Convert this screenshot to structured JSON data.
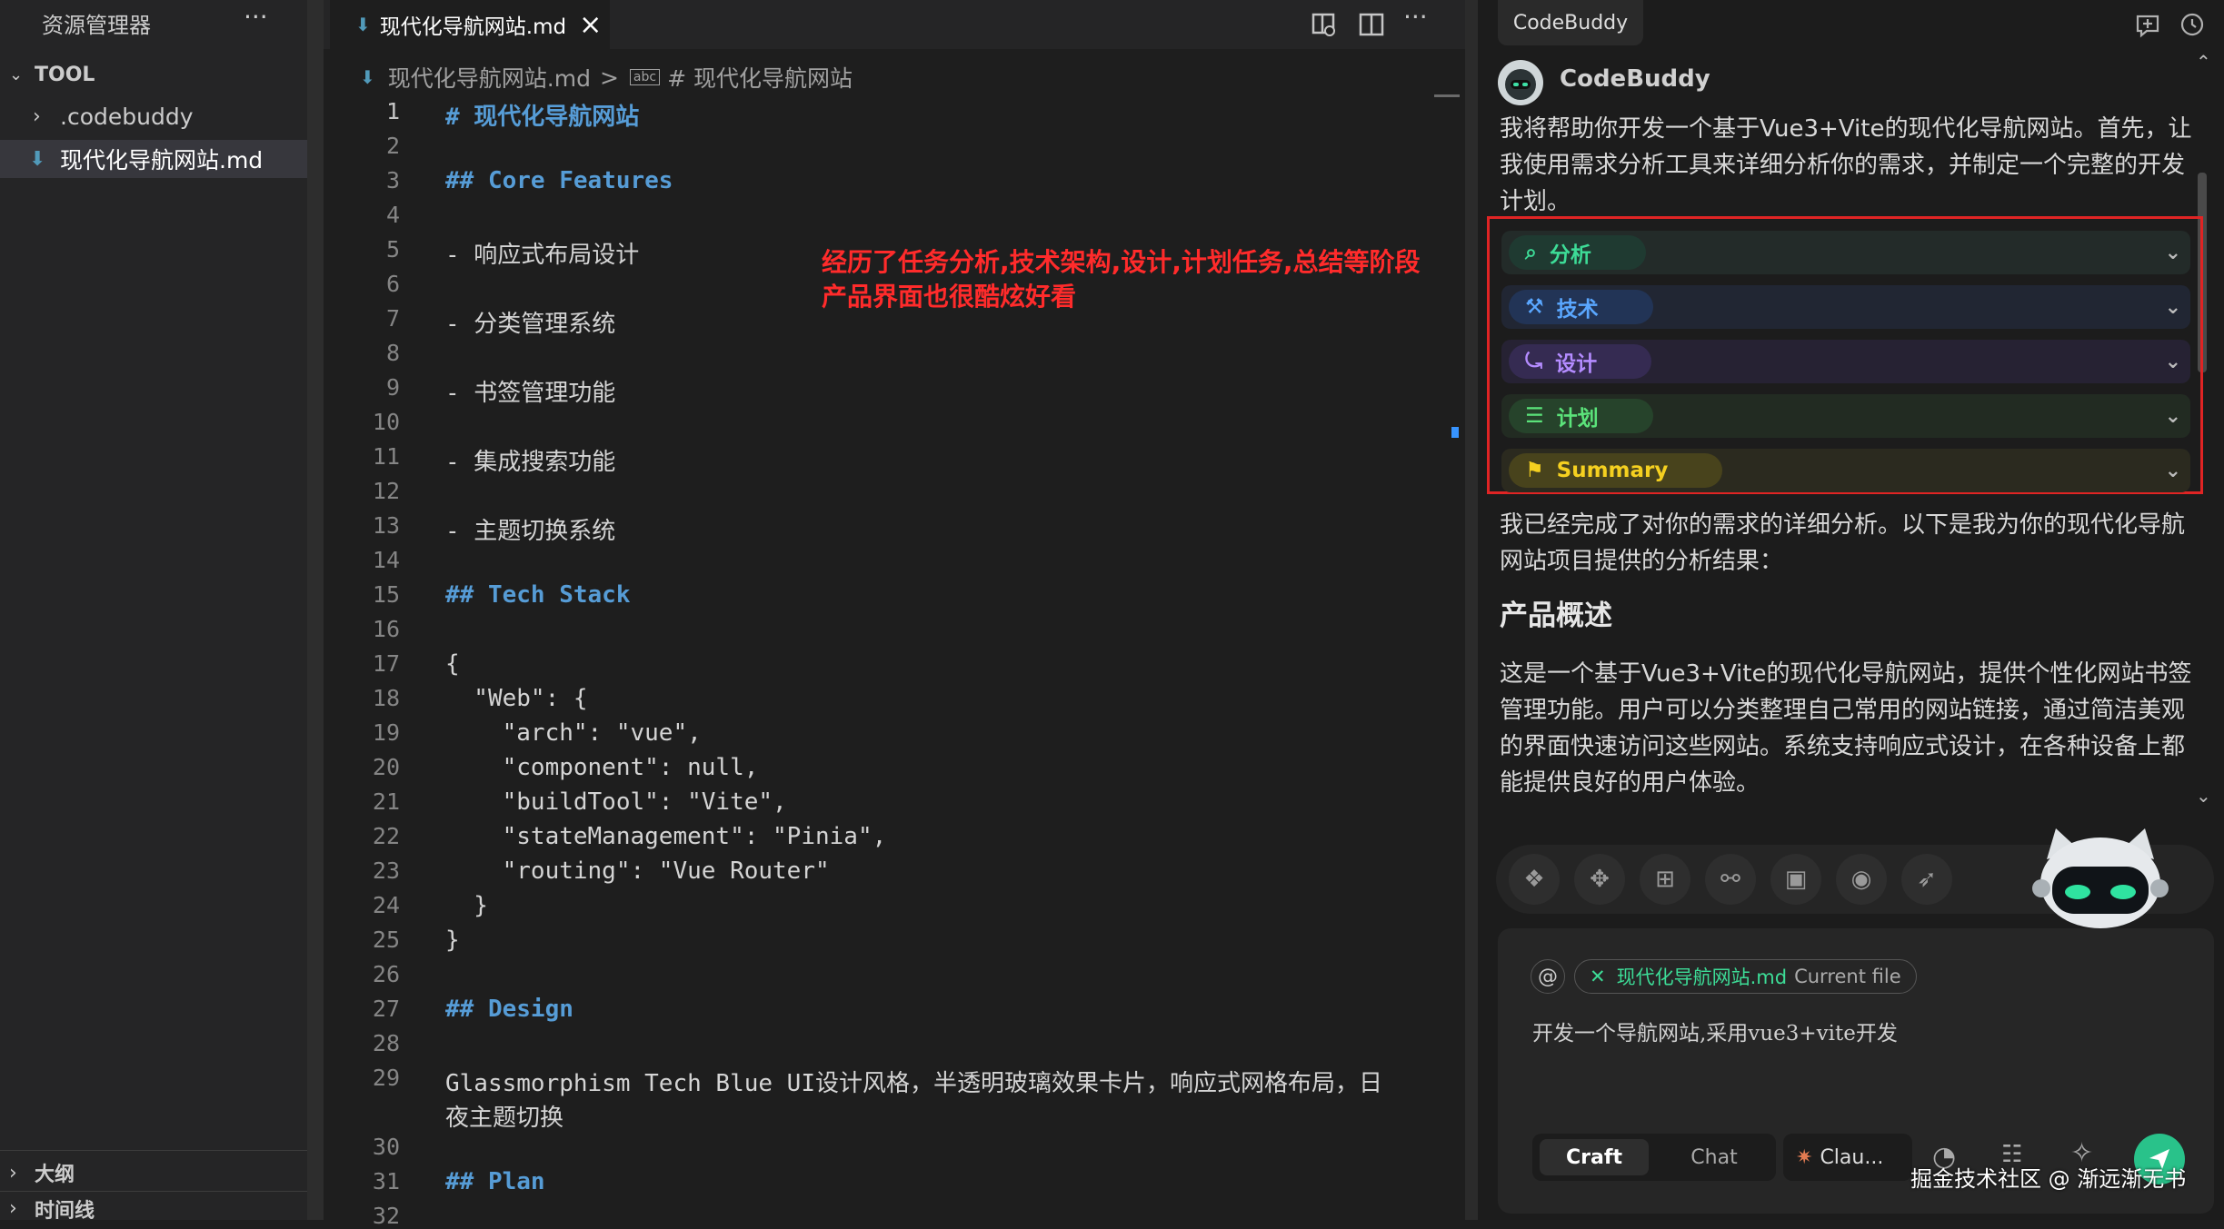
{
  "explorer": {
    "title": "资源管理器",
    "more": "···",
    "root": "TOOL",
    "items": [
      {
        "label": ".codebuddy"
      },
      {
        "label": "现代化导航网站.md"
      }
    ],
    "outline": "大纲",
    "timeline": "时间线"
  },
  "editor": {
    "tab_label": "现代化导航网站.md",
    "tab_close": "×",
    "breadcrumb_file": "现代化导航网站.md",
    "breadcrumb_sep": ">",
    "breadcrumb_symbol": "# 现代化导航网站",
    "lines": [
      {
        "n": "1",
        "t": "# 现代化导航网站",
        "k": "h"
      },
      {
        "n": "2",
        "t": "",
        "k": ""
      },
      {
        "n": "3",
        "t": "## Core Features",
        "k": "h"
      },
      {
        "n": "4",
        "t": "",
        "k": ""
      },
      {
        "n": "5",
        "t": "- 响应式布局设计",
        "k": "li"
      },
      {
        "n": "6",
        "t": "",
        "k": ""
      },
      {
        "n": "7",
        "t": "- 分类管理系统",
        "k": "li"
      },
      {
        "n": "8",
        "t": "",
        "k": ""
      },
      {
        "n": "9",
        "t": "- 书签管理功能",
        "k": "li"
      },
      {
        "n": "10",
        "t": "",
        "k": ""
      },
      {
        "n": "11",
        "t": "- 集成搜索功能",
        "k": "li"
      },
      {
        "n": "12",
        "t": "",
        "k": ""
      },
      {
        "n": "13",
        "t": "- 主题切换系统",
        "k": "li"
      },
      {
        "n": "14",
        "t": "",
        "k": ""
      },
      {
        "n": "15",
        "t": "## Tech Stack",
        "k": "h"
      },
      {
        "n": "16",
        "t": "",
        "k": ""
      },
      {
        "n": "17",
        "t": "{",
        "k": ""
      },
      {
        "n": "18",
        "t": "  \"Web\": {",
        "k": ""
      },
      {
        "n": "19",
        "t": "    \"arch\": \"vue\",",
        "k": ""
      },
      {
        "n": "20",
        "t": "    \"component\": null,",
        "k": ""
      },
      {
        "n": "21",
        "t": "    \"buildTool\": \"Vite\",",
        "k": ""
      },
      {
        "n": "22",
        "t": "    \"stateManagement\": \"Pinia\",",
        "k": ""
      },
      {
        "n": "23",
        "t": "    \"routing\": \"Vue Router\"",
        "k": ""
      },
      {
        "n": "24",
        "t": "  }",
        "k": ""
      },
      {
        "n": "25",
        "t": "}",
        "k": ""
      },
      {
        "n": "26",
        "t": "",
        "k": ""
      },
      {
        "n": "27",
        "t": "## Design",
        "k": "h"
      },
      {
        "n": "28",
        "t": "",
        "k": ""
      },
      {
        "n": "29",
        "t": "Glassmorphism Tech Blue UI设计风格，半透明玻璃效果卡片，响应式网格布局，日",
        "k": ""
      },
      {
        "n": "",
        "t": "夜主题切换",
        "k": ""
      },
      {
        "n": "30",
        "t": "",
        "k": ""
      },
      {
        "n": "31",
        "t": "## Plan",
        "k": "h"
      },
      {
        "n": "32",
        "t": "",
        "k": ""
      }
    ],
    "annotation_line1": "经历了任务分析,技术架构,设计,计划任务,总结等阶段",
    "annotation_line2": "产品界面也很酷炫好看"
  },
  "codebuddy": {
    "tab": "CodeBuddy",
    "name": "CodeBuddy",
    "intro": [
      "我将帮助你开发一个基于Vue3+Vite的现代化导航网站。首先，让",
      "我使用需求分析工具来详细分析你的需求，并制定一个完整的开发",
      "计划。"
    ],
    "stages": [
      {
        "label": "分析",
        "color": "#3ddc97"
      },
      {
        "label": "技术",
        "color": "#5aa7ff"
      },
      {
        "label": "设计",
        "color": "#b48cff"
      },
      {
        "label": "计划",
        "color": "#5be37a"
      },
      {
        "label": "Summary",
        "color": "#f5d020"
      }
    ],
    "result_intro": [
      "我已经完成了对你的需求的详细分析。以下是我为你的现代化导航",
      "网站项目提供的分析结果："
    ],
    "heading": "产品概述",
    "overview": [
      "这是一个基于Vue3+Vite的现代化导航网站，提供个性化网站书签",
      "管理功能。用户可以分类整理自己常用的网站链接，通过简洁美观",
      "的界面快速访问这些网站。系统支持响应式设计，在各种设备上都",
      "能提供良好的用户体验。"
    ],
    "context_at": "@",
    "context_file": "现代化导航网站.md",
    "context_note": "Current file",
    "input_text": "开发一个导航网站,采用vue3+vite开发",
    "mode_craft": "Craft",
    "mode_chat": "Chat",
    "model": "Clau...",
    "watermark": "掘金技术社区 @ 渐远渐无书"
  }
}
